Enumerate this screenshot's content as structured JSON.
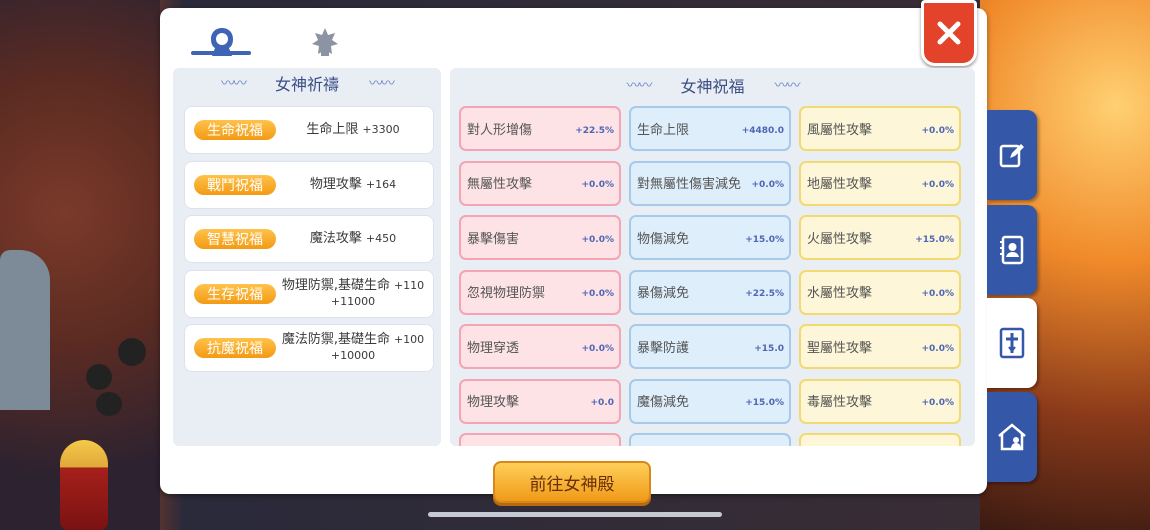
{
  "tabs": [
    {
      "icon": "goddess-icon",
      "active": true
    },
    {
      "icon": "emblem-icon",
      "active": false
    }
  ],
  "left_panel": {
    "title": "女神祈禱",
    "rows": [
      {
        "tag": "生命祝福",
        "line1": "生命上限",
        "value1": "+3300",
        "line2": ""
      },
      {
        "tag": "戰鬥祝福",
        "line1": "物理攻擊",
        "value1": "+164",
        "line2": ""
      },
      {
        "tag": "智慧祝福",
        "line1": "魔法攻擊",
        "value1": "+450",
        "line2": ""
      },
      {
        "tag": "生存祝福",
        "line1": "物理防禦,基礎生命",
        "value1": "+110",
        "line2": "+11000"
      },
      {
        "tag": "抗魔祝福",
        "line1": "魔法防禦,基礎生命",
        "value1": "+100",
        "line2": "+10000"
      }
    ]
  },
  "right_panel": {
    "title": "女神祝福",
    "columns": [
      [
        {
          "name": "對人形增傷",
          "value": "+22.5%"
        },
        {
          "name": "無屬性攻擊",
          "value": "+0.0%"
        },
        {
          "name": "暴擊傷害",
          "value": "+0.0%"
        },
        {
          "name": "忽視物理防禦",
          "value": "+0.0%"
        },
        {
          "name": "物理穿透",
          "value": "+0.0%"
        },
        {
          "name": "物理攻擊",
          "value": "+0.0"
        }
      ],
      [
        {
          "name": "生命上限",
          "value": "+4480.0"
        },
        {
          "name": "對無屬性傷害減免",
          "value": "+0.0%"
        },
        {
          "name": "物傷減免",
          "value": "+15.0%"
        },
        {
          "name": "暴傷減免",
          "value": "+22.5%"
        },
        {
          "name": "暴擊防護",
          "value": "+15.0"
        },
        {
          "name": "魔傷減免",
          "value": "+15.0%"
        }
      ],
      [
        {
          "name": "風屬性攻擊",
          "value": "+0.0%"
        },
        {
          "name": "地屬性攻擊",
          "value": "+0.0%"
        },
        {
          "name": "火屬性攻擊",
          "value": "+15.0%"
        },
        {
          "name": "水屬性攻擊",
          "value": "+0.0%"
        },
        {
          "name": "聖屬性攻擊",
          "value": "+0.0%"
        },
        {
          "name": "毒屬性攻擊",
          "value": "+0.0%"
        }
      ]
    ]
  },
  "go_button": "前往女神殿",
  "side_tabs": [
    {
      "icon": "edit-icon",
      "active": false
    },
    {
      "icon": "contacts-book-icon",
      "active": false
    },
    {
      "icon": "cross-icon",
      "active": true
    },
    {
      "icon": "home-icon",
      "active": false
    }
  ],
  "colors": {
    "accent": "#3457a8",
    "button": "#f2a21e",
    "close": "#e2432a"
  }
}
